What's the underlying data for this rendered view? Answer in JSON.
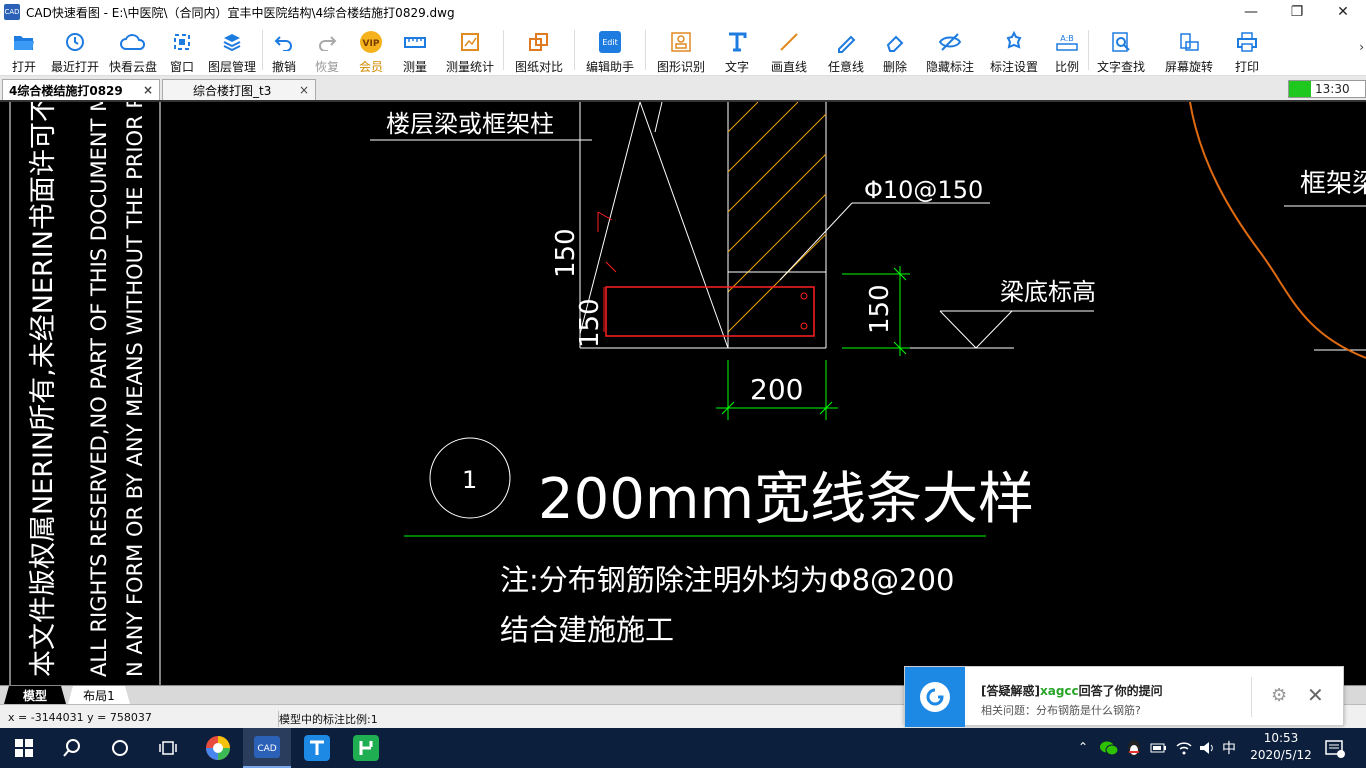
{
  "window": {
    "title": "CAD快速看图 - E:\\中医院\\（合同内）宜丰中医院结构\\4综合楼结施打0829.dwg",
    "app_icon_text": "CAD"
  },
  "toolbar": {
    "items": [
      {
        "label": "打开",
        "icon": "folder-open-icon"
      },
      {
        "label": "最近打开",
        "icon": "clock-history-icon"
      },
      {
        "label": "快看云盘",
        "icon": "cloud-icon"
      },
      {
        "label": "窗口",
        "icon": "window-icon"
      },
      {
        "label": "图层管理",
        "icon": "layers-icon"
      },
      {
        "label": "撤销",
        "icon": "undo-icon"
      },
      {
        "label": "恢复",
        "icon": "redo-icon"
      },
      {
        "label": "会员",
        "icon": "vip-icon",
        "badge": "VIP"
      },
      {
        "label": "测量",
        "icon": "ruler-icon"
      },
      {
        "label": "测量统计",
        "icon": "measure-stats-icon"
      },
      {
        "label": "图纸对比",
        "icon": "compare-icon"
      },
      {
        "label": "编辑助手",
        "icon": "edit-assistant-icon",
        "badge": "Edit"
      },
      {
        "label": "图形识别",
        "icon": "shape-recognition-icon"
      },
      {
        "label": "文字",
        "icon": "text-icon"
      },
      {
        "label": "画直线",
        "icon": "line-icon"
      },
      {
        "label": "任意线",
        "icon": "freehand-icon"
      },
      {
        "label": "删除",
        "icon": "eraser-icon"
      },
      {
        "label": "隐藏标注",
        "icon": "hide-eye-icon"
      },
      {
        "label": "标注设置",
        "icon": "annotation-settings-icon"
      },
      {
        "label": "比例",
        "icon": "scale-icon",
        "badge": "A:B"
      },
      {
        "label": "文字查找",
        "icon": "text-search-icon"
      },
      {
        "label": "屏幕旋转",
        "icon": "rotate-screen-icon"
      },
      {
        "label": "打印",
        "icon": "printer-icon"
      }
    ],
    "more": "›"
  },
  "tabs": [
    {
      "label": "4综合楼结施打0829",
      "active": true
    },
    {
      "label": "综合楼打图_t3",
      "active": false
    }
  ],
  "tab_close": "×",
  "clock_box": "13:30",
  "drawing": {
    "label_floor_beam": "楼层梁或框架柱",
    "label_frame_beam": "框架梁",
    "label_rebar": "Φ10@150",
    "label_beam_bottom": "梁底标高",
    "dim_150_a": "150",
    "dim_150_b": "150",
    "dim_150_c": "150",
    "dim_200": "200",
    "detail_number": "1",
    "detail_title": "200mm宽线条大样",
    "note_line1": "注:分布钢筋除注明外均为Φ8@200",
    "note_line2": "结合建施施工",
    "vertical_text_1": "本文件版权属NERIN所有,未经NERIN书面许可不准复制",
    "vertical_text_2": "ALL RIGHTS RESERVED,NO PART OF THIS DOCUMENT MAY BE R",
    "vertical_text_3": "N ANY FORM OR BY ANY MEANS WITHOUT THE PRIOR PERMIS",
    "colors": {
      "white": "#ffffff",
      "green": "#00ff00",
      "red": "#ff2020",
      "orange": "#e06a10",
      "yellow": "#e8a000"
    }
  },
  "layout_tabs": {
    "model": "模型",
    "layout1": "布局1"
  },
  "status": {
    "coords": "x = -3144031  y = 758037",
    "scale": "模型中的标注比例:1"
  },
  "notification": {
    "tag": "[答疑解惑]",
    "user": "xagcc",
    "action": "回答了你的提问",
    "related": "相关问题：分布钢筋是什么钢筋?"
  },
  "taskbar": {
    "time": "10:53",
    "date": "2020/5/12",
    "ime": "中",
    "apps": [
      "start-icon",
      "search-icon",
      "cortana-icon",
      "task-view-icon",
      "browser-icon",
      "cad-viewer-icon",
      "text-app-icon",
      "green-app-icon"
    ]
  }
}
